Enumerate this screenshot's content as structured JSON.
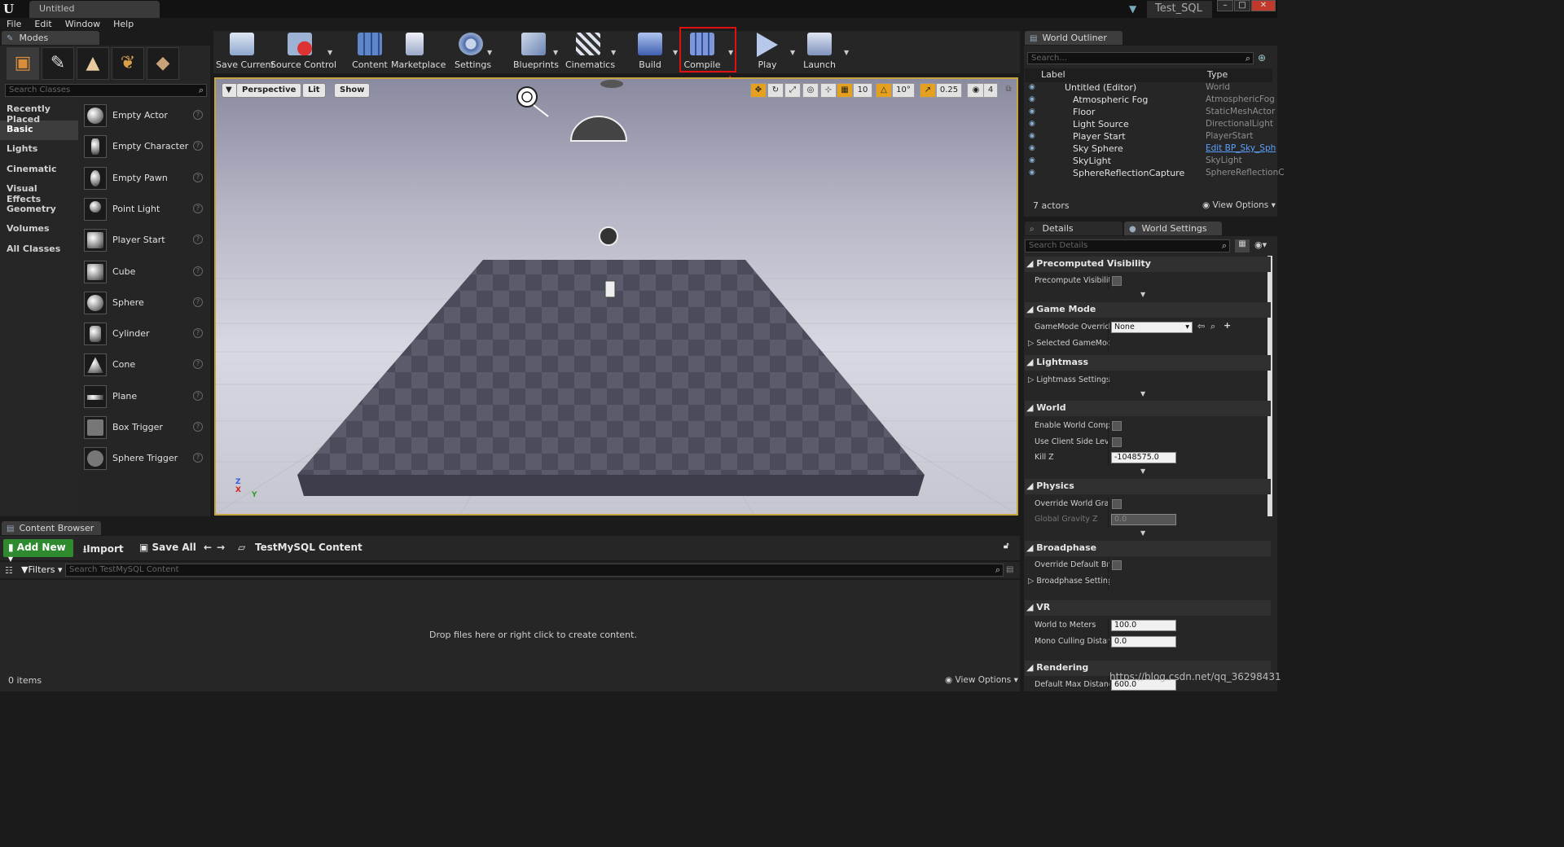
{
  "window": {
    "tab_title": "Untitled",
    "project": "Test_SQL"
  },
  "menu": [
    "File",
    "Edit",
    "Window",
    "Help"
  ],
  "modes": {
    "tab": "Modes",
    "search_placeholder": "Search Classes",
    "categories": [
      "Recently Placed",
      "Basic",
      "Lights",
      "Cinematic",
      "Visual Effects",
      "Geometry",
      "Volumes",
      "All Classes"
    ],
    "selected_category": "Basic",
    "items": [
      "Empty Actor",
      "Empty Character",
      "Empty Pawn",
      "Point Light",
      "Player Start",
      "Cube",
      "Sphere",
      "Cylinder",
      "Cone",
      "Plane",
      "Box Trigger",
      "Sphere Trigger"
    ]
  },
  "toolbar": {
    "buttons": [
      "Save Current",
      "Source Control",
      "Content",
      "Marketplace",
      "Settings",
      "Blueprints",
      "Cinematics",
      "Build",
      "Compile",
      "Play",
      "Launch"
    ]
  },
  "viewport": {
    "perspective": "Perspective",
    "lit": "Lit",
    "show": "Show",
    "grid_snap": "10",
    "rot_snap": "10°",
    "scale_snap": "0.25",
    "cam_speed": "4",
    "axis_z": "Z",
    "axis_x": "X",
    "axis_y": "Y"
  },
  "outliner": {
    "tab": "World Outliner",
    "search_placeholder": "Search...",
    "col_label": "Label",
    "col_type": "Type",
    "rows": [
      {
        "label": "Untitled (Editor)",
        "type": "World"
      },
      {
        "label": "Atmospheric Fog",
        "type": "AtmosphericFog"
      },
      {
        "label": "Floor",
        "type": "StaticMeshActor"
      },
      {
        "label": "Light Source",
        "type": "DirectionalLight"
      },
      {
        "label": "Player Start",
        "type": "PlayerStart"
      },
      {
        "label": "Sky Sphere",
        "type": "Edit BP_Sky_Sph"
      },
      {
        "label": "SkyLight",
        "type": "SkyLight"
      },
      {
        "label": "SphereReflectionCapture",
        "type": "SphereReflectionC"
      }
    ],
    "count": "7 actors",
    "view_options": "View Options"
  },
  "details": {
    "tab_details": "Details",
    "tab_world": "World Settings",
    "search_placeholder": "Search Details",
    "sections": {
      "precomputed": "Precomputed Visibility",
      "precompute_vis": "Precompute Visibility",
      "gamemode": "Game Mode",
      "gamemode_override": "GameMode Override",
      "gamemode_value": "None",
      "selected_gamemode": "Selected GameMode",
      "lightmass": "Lightmass",
      "lightmass_settings": "Lightmass Settings",
      "world": "World",
      "enable_comp": "Enable World Composi",
      "client_side": "Use Client Side Level !",
      "killz": "Kill Z",
      "killz_value": "-1048575.0",
      "physics": "Physics",
      "override_gravity": "Override World Gravity",
      "global_gravity": "Global Gravity Z",
      "gravity_value": "0.0",
      "broadphase": "Broadphase",
      "override_broad": "Override Default Broac",
      "broad_settings": "Broadphase Settings",
      "vr": "VR",
      "world_to_meters": "World to Meters",
      "wtm_value": "100.0",
      "mono_culling": "Mono Culling Distance",
      "mono_value": "0.0",
      "rendering": "Rendering",
      "default_max": "Default Max Distance",
      "default_max_value": "600.0"
    }
  },
  "content_browser": {
    "tab": "Content Browser",
    "add_new": "Add New",
    "import": "Import",
    "save_all": "Save All",
    "path": "TestMySQL Content",
    "filters": "Filters",
    "search_placeholder": "Search TestMySQL Content",
    "drop_hint": "Drop files here or right click to create content.",
    "count": "0 items",
    "view_options": "View Options"
  },
  "watermark": "https://blog.csdn.net/qq_36298431",
  "colors": {
    "highlight": "#e01010",
    "selection_border": "#c8a23a",
    "add_new": "#2f8a2f"
  }
}
